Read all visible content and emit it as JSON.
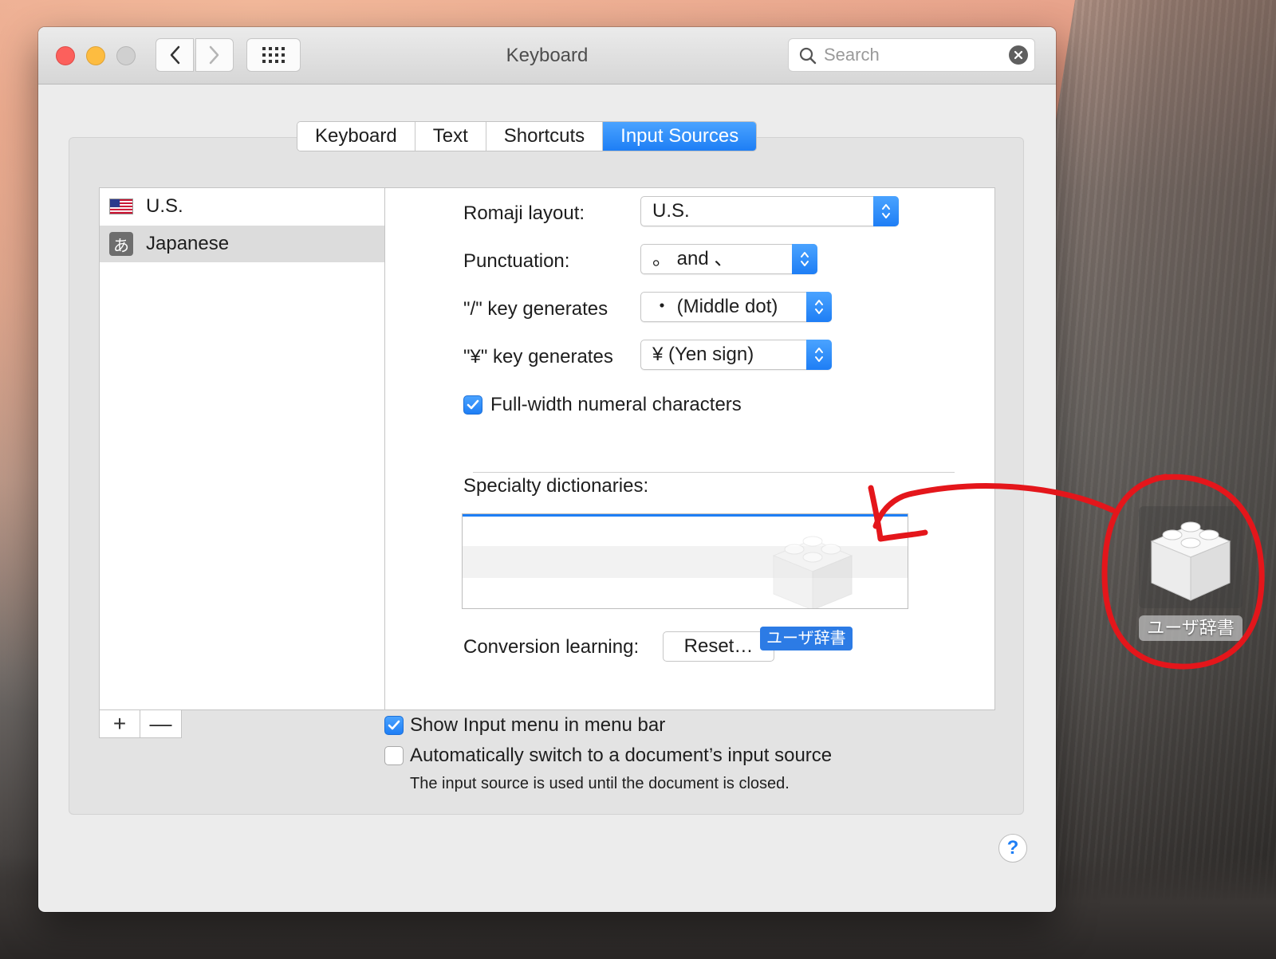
{
  "window": {
    "title": "Keyboard",
    "search_placeholder": "Search"
  },
  "tabs": [
    {
      "label": "Keyboard",
      "active": false
    },
    {
      "label": "Text",
      "active": false
    },
    {
      "label": "Shortcuts",
      "active": false
    },
    {
      "label": "Input Sources",
      "active": true
    }
  ],
  "sources": [
    {
      "label": "U.S.",
      "icon": "us-flag-icon",
      "selected": false
    },
    {
      "label": "Japanese",
      "icon": "hiragana-a-icon",
      "glyph": "あ",
      "selected": true
    }
  ],
  "settings": {
    "romaji_layout": {
      "label": "Romaji layout:",
      "value": "U.S."
    },
    "punctuation": {
      "label": "Punctuation:",
      "value": "。 and 、"
    },
    "slash_key": {
      "label": "\"/\" key generates",
      "value": "・ (Middle dot)"
    },
    "yen_key": {
      "label": "\"¥\" key generates",
      "value": "¥ (Yen sign)"
    },
    "full_width": {
      "label": "Full-width numeral characters",
      "checked": true
    },
    "specialty_dictionaries": {
      "label": "Specialty dictionaries:"
    },
    "conversion_learning": {
      "label": "Conversion learning:",
      "button": "Reset…"
    },
    "drag_badge": "ユーザ辞書"
  },
  "bottom": {
    "add_label": "+",
    "remove_label": "—",
    "show_input_menu": {
      "label": "Show Input menu in menu bar",
      "checked": true
    },
    "auto_switch": {
      "label": "Automatically switch to a document’s input source",
      "checked": false
    },
    "note": "The input source is used until the document is closed.",
    "help": "?"
  },
  "desktop": {
    "file_label": "ユーザ辞書",
    "file_icon": "lego-brick-plugin-icon"
  },
  "colors": {
    "accent": "#1e7ef5",
    "annotation": "#e4161b"
  }
}
